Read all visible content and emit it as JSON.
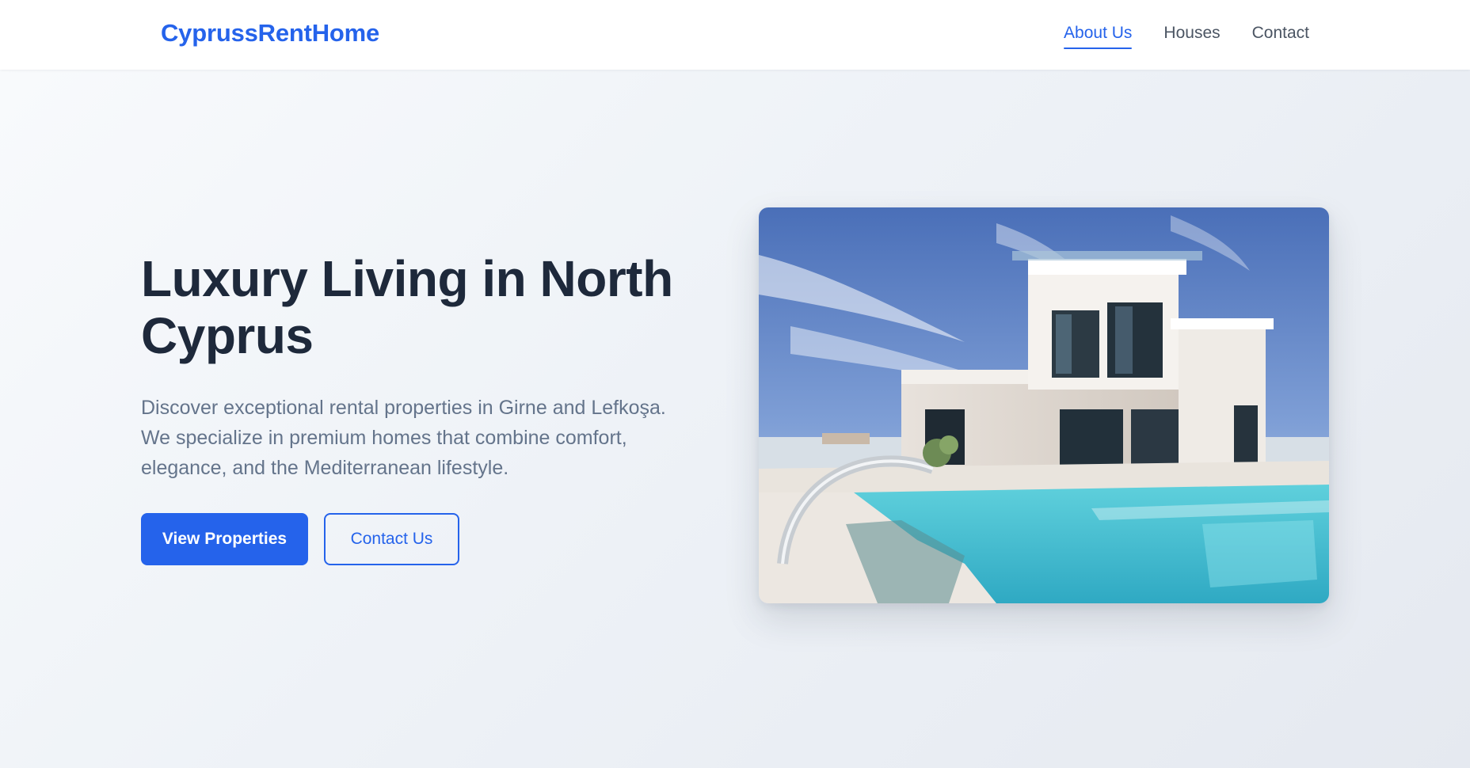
{
  "header": {
    "brand": "CyprussRentHome",
    "nav": [
      {
        "label": "About Us",
        "active": true
      },
      {
        "label": "Houses",
        "active": false
      },
      {
        "label": "Contact",
        "active": false
      }
    ]
  },
  "hero": {
    "title": "Luxury Living in North Cyprus",
    "description": "Discover exceptional rental properties in Girne and Lefkoşa. We specialize in premium homes that combine comfort, elegance, and the Mediterranean lifestyle.",
    "primary_button": "View Properties",
    "secondary_button": "Contact Us",
    "image_subject": "modern-villa-with-pool"
  },
  "colors": {
    "accent": "#2563eb",
    "heading": "#1e293b",
    "body_text": "#64748b",
    "nav_text": "#4b5563"
  }
}
